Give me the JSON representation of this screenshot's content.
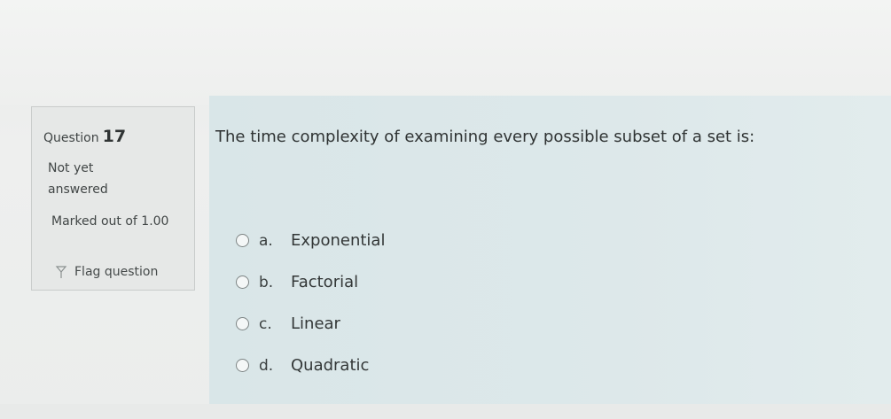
{
  "question_info": {
    "label": "Question",
    "number": "17",
    "status": "Not yet answered",
    "marked_out_of": "Marked out of 1.00",
    "flag_label": "Flag question"
  },
  "question": {
    "text": "The time complexity of examining every possible subset of a set is:",
    "options": [
      {
        "letter": "a.",
        "label": "Exponential"
      },
      {
        "letter": "b.",
        "label": "Factorial"
      },
      {
        "letter": "c.",
        "label": "Linear"
      },
      {
        "letter": "d.",
        "label": "Quadratic"
      }
    ]
  },
  "colors": {
    "panel_bg": "#dce7e9",
    "page_bg": "#eceeed",
    "text": "#333737"
  }
}
